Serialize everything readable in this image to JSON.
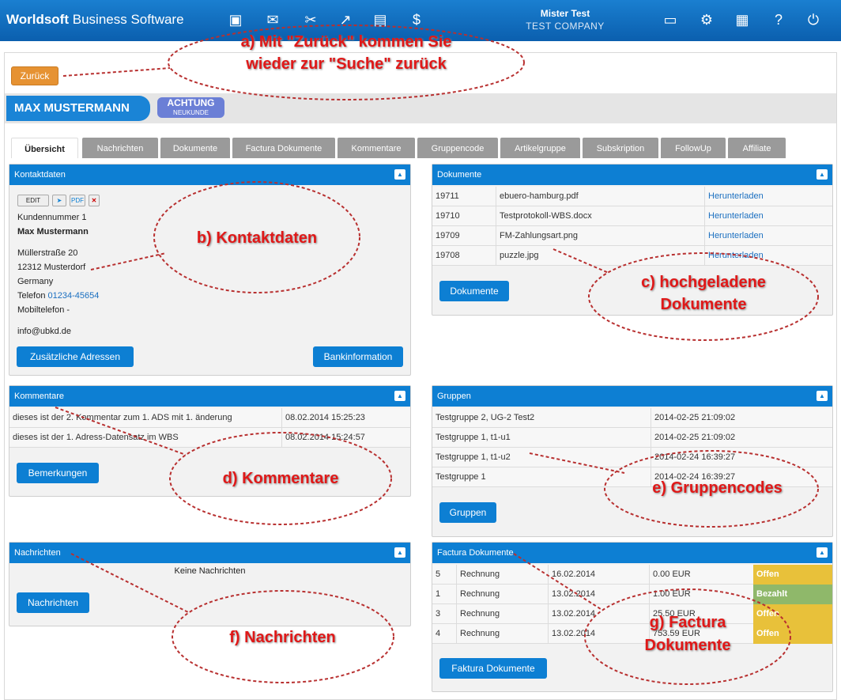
{
  "header": {
    "brand_bold": "Worldsoft",
    "brand_rest": "Business Software",
    "user_name": "Mister Test",
    "company": "TEST COMPANY"
  },
  "back_label": "Zurück",
  "customer": {
    "name": "MAX MUSTERMANN",
    "badge_title": "ACHTUNG",
    "badge_sub": "NEUKUNDE"
  },
  "tabs": [
    "Übersicht",
    "Nachrichten",
    "Dokumente",
    "Factura Dokumente",
    "Kommentare",
    "Gruppencode",
    "Artikelgruppe",
    "Subskription",
    "FollowUp",
    "Affiliate"
  ],
  "contact": {
    "title": "Kontaktdaten",
    "edit": "EDIT",
    "pdf": "PDF",
    "kundennummer": "Kundennummer 1",
    "name": "Max Mustermann",
    "street": "Müllerstraße 20",
    "city": "12312 Musterdorf",
    "country": "Germany",
    "phone_label": "Telefon",
    "phone": "01234-45654",
    "mobile": "Mobiltelefon -",
    "email": "info@ubkd.de",
    "btn_addresses": "Zusätzliche Adressen",
    "btn_bank": "Bankinformation"
  },
  "documents": {
    "title": "Dokumente",
    "rows": [
      {
        "id": "19711",
        "file": "ebuero-hamburg.pdf",
        "action": "Herunterladen"
      },
      {
        "id": "19710",
        "file": "Testprotokoll-WBS.docx",
        "action": "Herunterladen"
      },
      {
        "id": "19709",
        "file": "FM-Zahlungsart.png",
        "action": "Herunterladen"
      },
      {
        "id": "19708",
        "file": "puzzle.jpg",
        "action": "Herunterladen"
      }
    ],
    "btn": "Dokumente"
  },
  "comments": {
    "title": "Kommentare",
    "rows": [
      {
        "text": "dieses ist der 2. Kommentar zum 1. ADS mit 1. änderung",
        "date": "08.02.2014 15:25:23"
      },
      {
        "text": "dieses ist der 1. Adress-Datensatz im WBS",
        "date": "08.02.2014 15:24:57"
      }
    ],
    "btn": "Bemerkungen"
  },
  "groups": {
    "title": "Gruppen",
    "rows": [
      {
        "name": "Testgruppe 2, UG-2 Test2",
        "date": "2014-02-25 21:09:02"
      },
      {
        "name": "Testgruppe 1, t1-u1",
        "date": "2014-02-25 21:09:02"
      },
      {
        "name": "Testgruppe 1, t1-u2",
        "date": "2014-02-24 16:39:27"
      },
      {
        "name": "Testgruppe 1",
        "date": "2014-02-24 16:39:27"
      }
    ],
    "btn": "Gruppen"
  },
  "messages": {
    "title": "Nachrichten",
    "empty": "Keine Nachrichten",
    "btn": "Nachrichten"
  },
  "factura": {
    "title": "Factura Dokumente",
    "rows": [
      {
        "no": "5",
        "type": "Rechnung",
        "date": "16.02.2014",
        "amount": "0.00 EUR",
        "status": "Offen",
        "color": "#e8c13a"
      },
      {
        "no": "1",
        "type": "Rechnung",
        "date": "13.02.2014",
        "amount": "1.00 EUR",
        "status": "Bezahlt",
        "color": "#8fb86a"
      },
      {
        "no": "3",
        "type": "Rechnung",
        "date": "13.02.2014",
        "amount": "25.50 EUR",
        "status": "Offen",
        "color": "#e8c13a"
      },
      {
        "no": "4",
        "type": "Rechnung",
        "date": "13.02.2014",
        "amount": "753.59 EUR",
        "status": "Offen",
        "color": "#e8c13a"
      }
    ],
    "btn": "Faktura Dokumente"
  },
  "annotations": {
    "a1": "a) Mit \"Zurück\" kommen Sie",
    "a2": "wieder zur \"Suche\" zurück",
    "b": "b) Kontaktdaten",
    "c1": "c) hochgeladene",
    "c2": "Dokumente",
    "d": "d) Kommentare",
    "e": "e) Gruppencodes",
    "f": "f) Nachrichten",
    "g1": "g) Factura",
    "g2": "Dokumente"
  },
  "icons": [
    "contacts-icon",
    "mail-icon",
    "tools-icon",
    "chart-icon",
    "invoice-icon",
    "dollar-icon",
    "chat-icon",
    "settings-icon",
    "print-icon",
    "help-icon",
    "power-icon"
  ]
}
